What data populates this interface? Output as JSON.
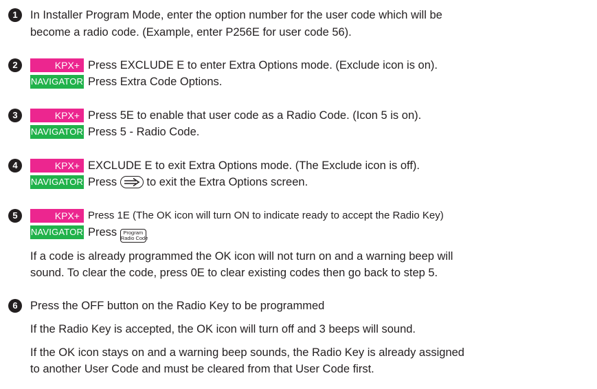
{
  "step_numbers": [
    "1",
    "2",
    "3",
    "4",
    "5",
    "6"
  ],
  "badges": {
    "kpx": "KPX+",
    "navigator": "NAVIGATOR"
  },
  "step1": {
    "line1": "In Installer Program Mode, enter the option number for the user code which will be",
    "line2": "become a radio code. (Example, enter P256E for user code 56)."
  },
  "step2": {
    "kpx_text": "Press EXCLUDE E to enter Extra Options mode. (Exclude icon is on).",
    "nav_text": "Press Extra Code Options."
  },
  "step3": {
    "kpx_text": "Press 5E to enable that user code as a Radio Code. (Icon 5 is on).",
    "nav_text": "Press 5 - Radio Code."
  },
  "step4": {
    "kpx_text": "EXCLUDE E to exit Extra Options mode. (The Exclude icon is off).",
    "nav_before": "Press",
    "nav_after": "to exit the Extra Options screen.",
    "key_icon": "arrow-right-key-icon"
  },
  "step5": {
    "kpx_text": "Press 1E (The OK icon will turn ON to indicate ready to accept the Radio Key)",
    "nav_before": "Press",
    "key_line1": "Program",
    "key_line2": "Radio Code",
    "note1": "If a code is already programmed the OK icon will not turn on and a warning beep will",
    "note2": "sound. To clear the code, press 0E to clear existing codes then go back to step 5."
  },
  "step6": {
    "line1": "Press the OFF button on the Radio Key to be programmed",
    "line2": "If the Radio Key is accepted, the OK icon will turn off and 3 beeps will sound.",
    "line3": "If the OK icon stays on and a warning beep sounds, the Radio Key is already assigned",
    "line4": "to another User Code and must be cleared from that User Code first."
  },
  "colors": {
    "kpx_badge": "#ec268f",
    "navigator_badge": "#21b24b",
    "text": "#231f20"
  }
}
